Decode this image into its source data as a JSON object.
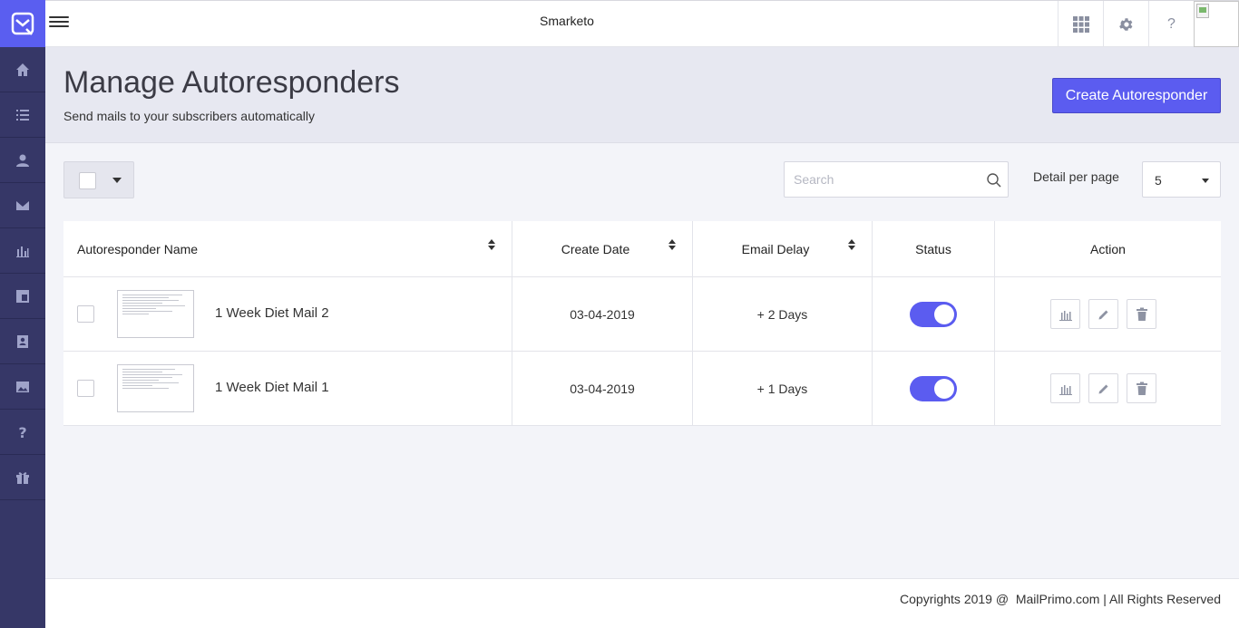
{
  "app": {
    "title": "Smarketo"
  },
  "sidebar": {
    "items": [
      {
        "icon": "home-icon"
      },
      {
        "icon": "list-icon"
      },
      {
        "icon": "user-icon"
      },
      {
        "icon": "mail-icon"
      },
      {
        "icon": "bar-chart-icon"
      },
      {
        "icon": "layout-icon"
      },
      {
        "icon": "contacts-book-icon"
      },
      {
        "icon": "image-icon"
      },
      {
        "icon": "help-icon"
      },
      {
        "icon": "gift-icon"
      }
    ]
  },
  "topbar": {
    "help_label": "?"
  },
  "header": {
    "title": "Manage Autoresponders",
    "subtitle": "Send mails to your subscribers automatically",
    "create_label": "Create Autoresponder"
  },
  "toolbar": {
    "search_placeholder": "Search",
    "per_page_label": "Detail per page",
    "per_page_value": "5"
  },
  "table": {
    "columns": [
      "Autoresponder Name",
      "Create Date",
      "Email Delay",
      "Status",
      "Action"
    ],
    "rows": [
      {
        "name": "1 Week Diet Mail 2",
        "date": "03-04-2019",
        "delay": "+ 2 Days",
        "status": "on"
      },
      {
        "name": "1 Week Diet Mail 1",
        "date": "03-04-2019",
        "delay": "+ 1 Days",
        "status": "on"
      }
    ]
  },
  "footer": {
    "copyright": "Copyrights 2019 @  MailPrimo.com | All Rights Reserved"
  },
  "colors": {
    "accent": "#5b5cf0",
    "sidebar": "#363767",
    "header_band": "#e7e8f1"
  }
}
